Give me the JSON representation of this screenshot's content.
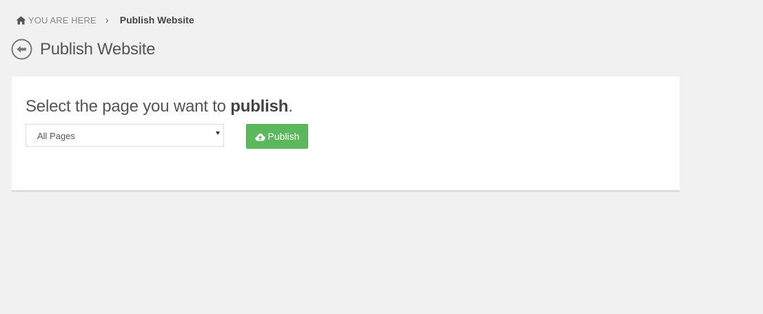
{
  "breadcrumb": {
    "home_icon": "home-icon",
    "home_label": "YOU ARE HERE",
    "separator": "›",
    "current": "Publish Website"
  },
  "header": {
    "back_icon": "arrow-left-circle-icon",
    "title": "Publish Website"
  },
  "main": {
    "prompt_prefix": "Select the page you want to ",
    "prompt_emphasis": "publish",
    "prompt_suffix": ".",
    "page_select": {
      "value": "All Pages"
    },
    "publish_button": {
      "icon": "cloud-upload-icon",
      "label": "Publish",
      "color": "#5cb85c"
    }
  },
  "colors": {
    "background": "#f1f1f1",
    "card": "#ffffff",
    "success": "#5cb85c"
  }
}
